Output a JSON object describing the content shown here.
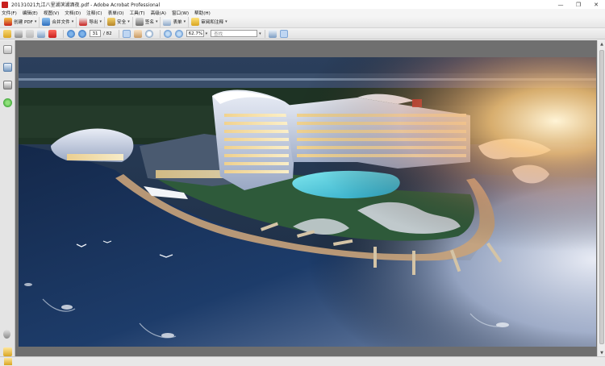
{
  "window": {
    "title": "20131021九江八里湖滨湖酒夜.pdf - Adobe Acrobat Professional",
    "minimize": "—",
    "maximize": "❐",
    "close": "✕"
  },
  "menu": {
    "items": [
      "文件(F)",
      "编辑(E)",
      "视图(V)",
      "文档(D)",
      "注释(C)",
      "表单(O)",
      "工具(T)",
      "高级(A)",
      "窗口(W)",
      "帮助(H)"
    ]
  },
  "toolbar1": {
    "create_pdf": "创建 PDF",
    "combine": "合并文件",
    "export": "导出",
    "security": "安全",
    "sign": "签名",
    "forms": "表单",
    "review": "审阅和注释"
  },
  "toolbar2": {
    "current_page": "31",
    "page_total": "/ 82",
    "zoom": "62.7%",
    "find_placeholder": "查找"
  },
  "colors": {
    "accent_blue": "#2f6fbf",
    "acrobat_red": "#c8201d",
    "doc_background": "#6f6f6f"
  },
  "icons": {
    "nav": [
      "pages-icon",
      "bookmarks-icon",
      "signatures-icon",
      "help-icon",
      "attachments-icon",
      "comments-icon"
    ]
  }
}
